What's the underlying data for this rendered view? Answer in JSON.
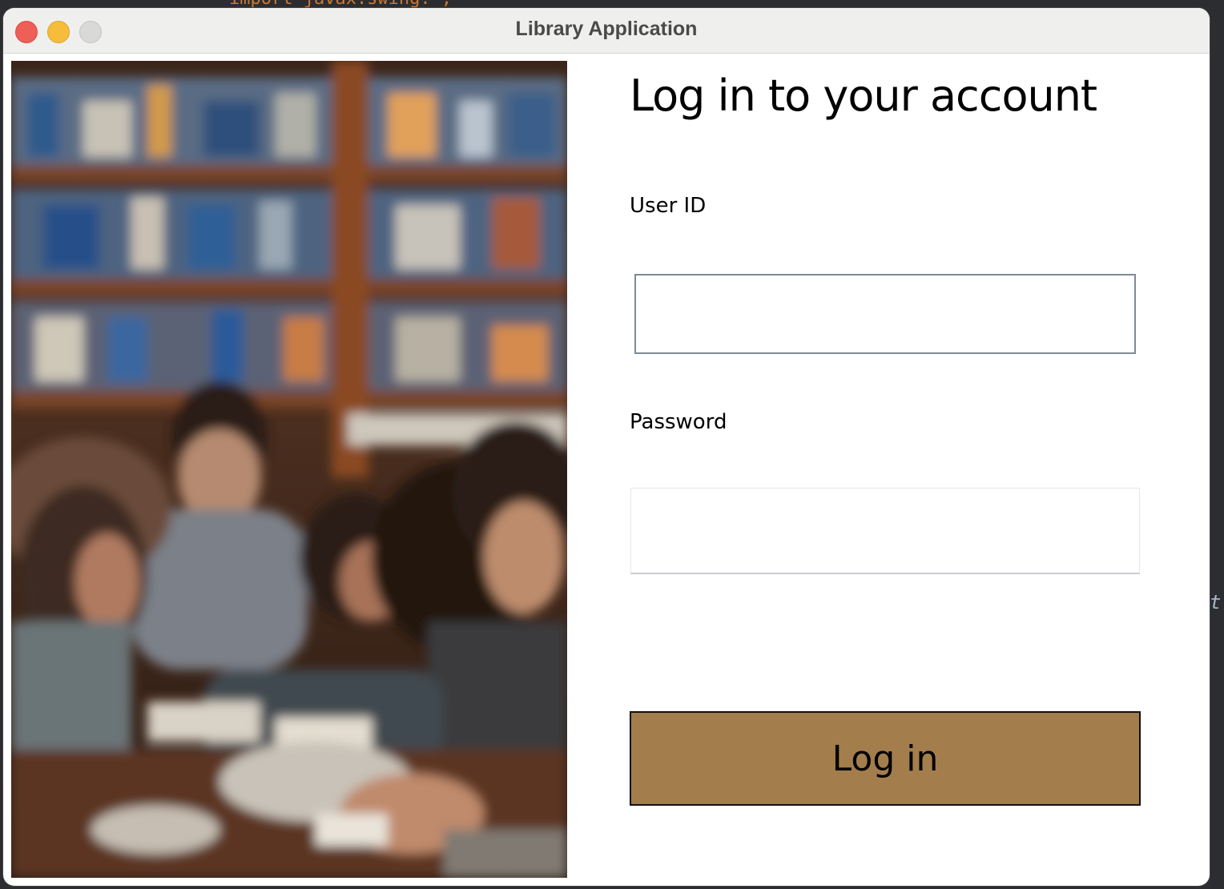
{
  "window": {
    "title": "Library Application"
  },
  "background_code": {
    "fragment_top": "import javax.swing.*;",
    "fragment_right": "t"
  },
  "login": {
    "heading": "Log in to your account",
    "user_id_label": "User ID",
    "user_id_value": "",
    "password_label": "Password",
    "password_value": "",
    "button_label": "Log in"
  },
  "colors": {
    "button_background": "#a47d4d",
    "close": "#ee5f57",
    "minimize": "#f6bd3b",
    "maximize": "#d9d9d7"
  },
  "image": {
    "icon": "library-photo"
  }
}
